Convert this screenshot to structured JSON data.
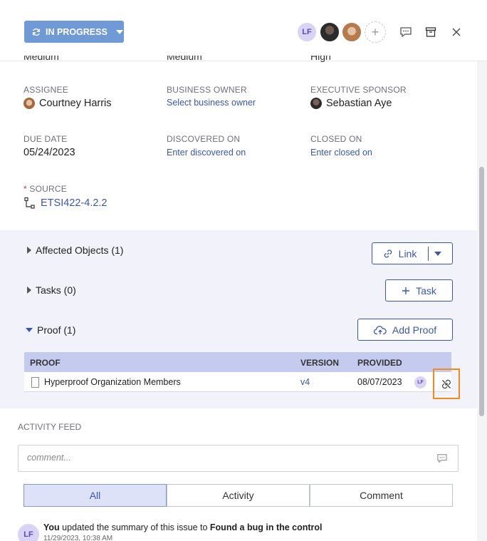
{
  "header": {
    "status_label": "IN PROGRESS",
    "avatar_initials": "LF",
    "add_label": "+"
  },
  "top_values": {
    "col1": "Medium",
    "col2": "Medium",
    "col3": "High"
  },
  "fields": {
    "assignee": {
      "label": "ASSIGNEE",
      "value": "Courtney Harris"
    },
    "business_owner": {
      "label": "BUSINESS OWNER",
      "value": "Select business owner"
    },
    "executive_sponsor": {
      "label": "EXECUTIVE SPONSOR",
      "value": "Sebastian Aye"
    },
    "due_date": {
      "label": "DUE DATE",
      "value": "05/24/2023"
    },
    "discovered_on": {
      "label": "DISCOVERED ON",
      "value": "Enter discovered on"
    },
    "closed_on": {
      "label": "CLOSED ON",
      "value": "Enter closed on"
    },
    "source": {
      "required": "*",
      "label": "SOURCE",
      "value": "ETSI422-4.2.2"
    }
  },
  "sections": {
    "affected": {
      "title": "Affected Objects (1)",
      "button": "Link"
    },
    "tasks": {
      "title": "Tasks (0)",
      "button": "Task"
    },
    "proof": {
      "title": "Proof (1)",
      "button": "Add Proof"
    }
  },
  "proof_table": {
    "headers": [
      "PROOF",
      "VERSION",
      "PROVIDED"
    ],
    "rows": [
      {
        "name": "Hyperproof Organization Members",
        "version": "v4",
        "provided": "08/07/2023",
        "user": "LF"
      }
    ]
  },
  "activity": {
    "label": "ACTIVITY FEED",
    "comment_placeholder": "comment...",
    "tabs": [
      "All",
      "Activity",
      "Comment"
    ],
    "item": {
      "actor": "You",
      "text": " updated the summary of this issue to ",
      "target": "Found a bug in the control",
      "time": "11/29/2023, 10:38 AM",
      "initials": "LF"
    }
  },
  "colors": {
    "accent": "#3a56b0",
    "status_button": "#6f9ad6",
    "highlight": "#f08c1e",
    "band": "#f1f2fa"
  }
}
